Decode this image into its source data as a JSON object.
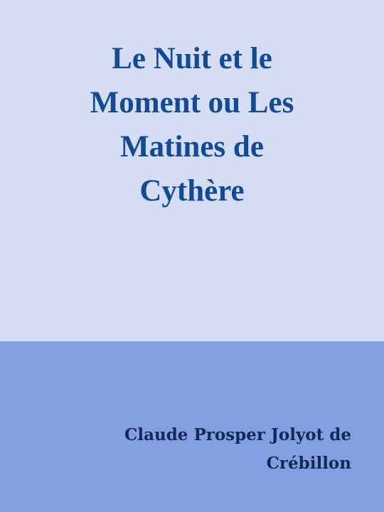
{
  "cover": {
    "title": "Le Nuit et le\nMoment ou Les\nMatines de\nCythère",
    "author": "Claude Prosper Jolyot de\nCrébillon",
    "colors": {
      "top_background": "#d4ddf4",
      "bottom_background": "#849fe0",
      "title_text": "#124b93",
      "author_text": "#0e2a59"
    }
  }
}
